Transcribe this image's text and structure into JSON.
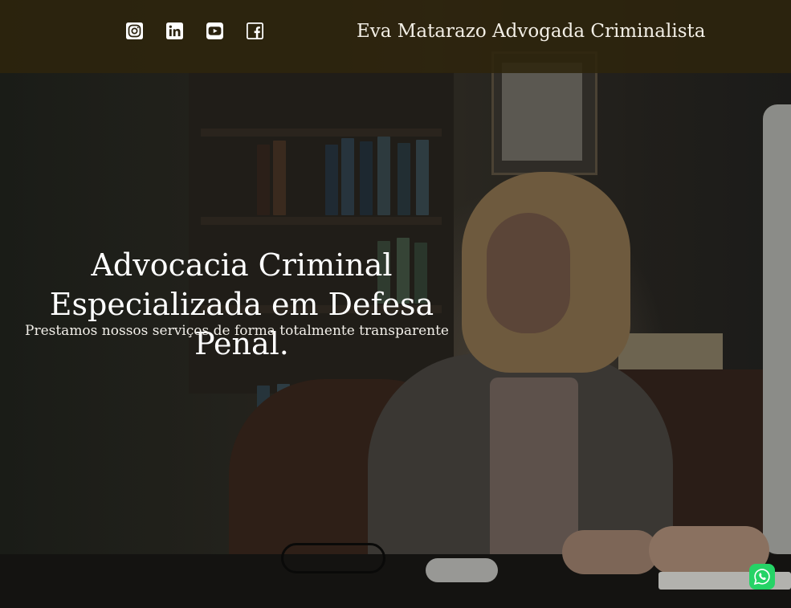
{
  "header": {
    "site_title": "Eva Matarazo Advogada Criminalista",
    "social_links": [
      {
        "icon": "instagram-icon"
      },
      {
        "icon": "linkedin-icon"
      },
      {
        "icon": "youtube-icon"
      },
      {
        "icon": "facebook-icon"
      }
    ]
  },
  "hero": {
    "headline_line1": "Advocacia Criminal",
    "headline_line2": "Especializada em Defesa Penal.",
    "subheadline": "Prestamos nossos serviços de forma totalmente transparente"
  },
  "floating": {
    "whatsapp_icon": "whatsapp-icon"
  },
  "colors": {
    "header_overlay": "#2e240c",
    "text": "#ffffff",
    "whatsapp": "#25d366"
  }
}
